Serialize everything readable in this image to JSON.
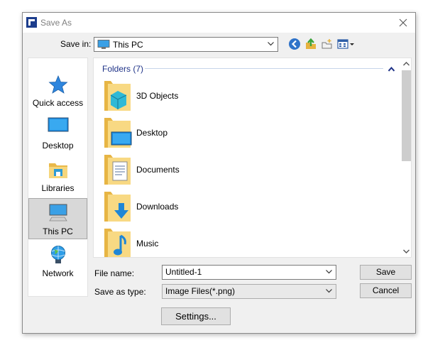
{
  "window": {
    "title": "Save As"
  },
  "save_in": {
    "label": "Save in:",
    "value": "This PC"
  },
  "places": [
    {
      "label": "Quick access",
      "icon": "star-icon"
    },
    {
      "label": "Desktop",
      "icon": "desktop-icon"
    },
    {
      "label": "Libraries",
      "icon": "libraries-icon"
    },
    {
      "label": "This PC",
      "icon": "computer-icon",
      "selected": true
    },
    {
      "label": "Network",
      "icon": "network-icon"
    }
  ],
  "group": {
    "header": "Folders (7)"
  },
  "folders": [
    {
      "name": "3D Objects",
      "icon": "3d-objects-folder-icon"
    },
    {
      "name": "Desktop",
      "icon": "desktop-folder-icon"
    },
    {
      "name": "Documents",
      "icon": "documents-folder-icon"
    },
    {
      "name": "Downloads",
      "icon": "downloads-folder-icon"
    },
    {
      "name": "Music",
      "icon": "music-folder-icon"
    }
  ],
  "file_name": {
    "label": "File name:",
    "value": "Untitled-1"
  },
  "save_as_type": {
    "label": "Save as type:",
    "value": "Image Files(*.png)"
  },
  "buttons": {
    "save": "Save",
    "cancel": "Cancel",
    "settings": "Settings..."
  },
  "colors": {
    "accent": "#1e3287",
    "folder": "#f3d27a",
    "selected": "#d8d8d8"
  }
}
